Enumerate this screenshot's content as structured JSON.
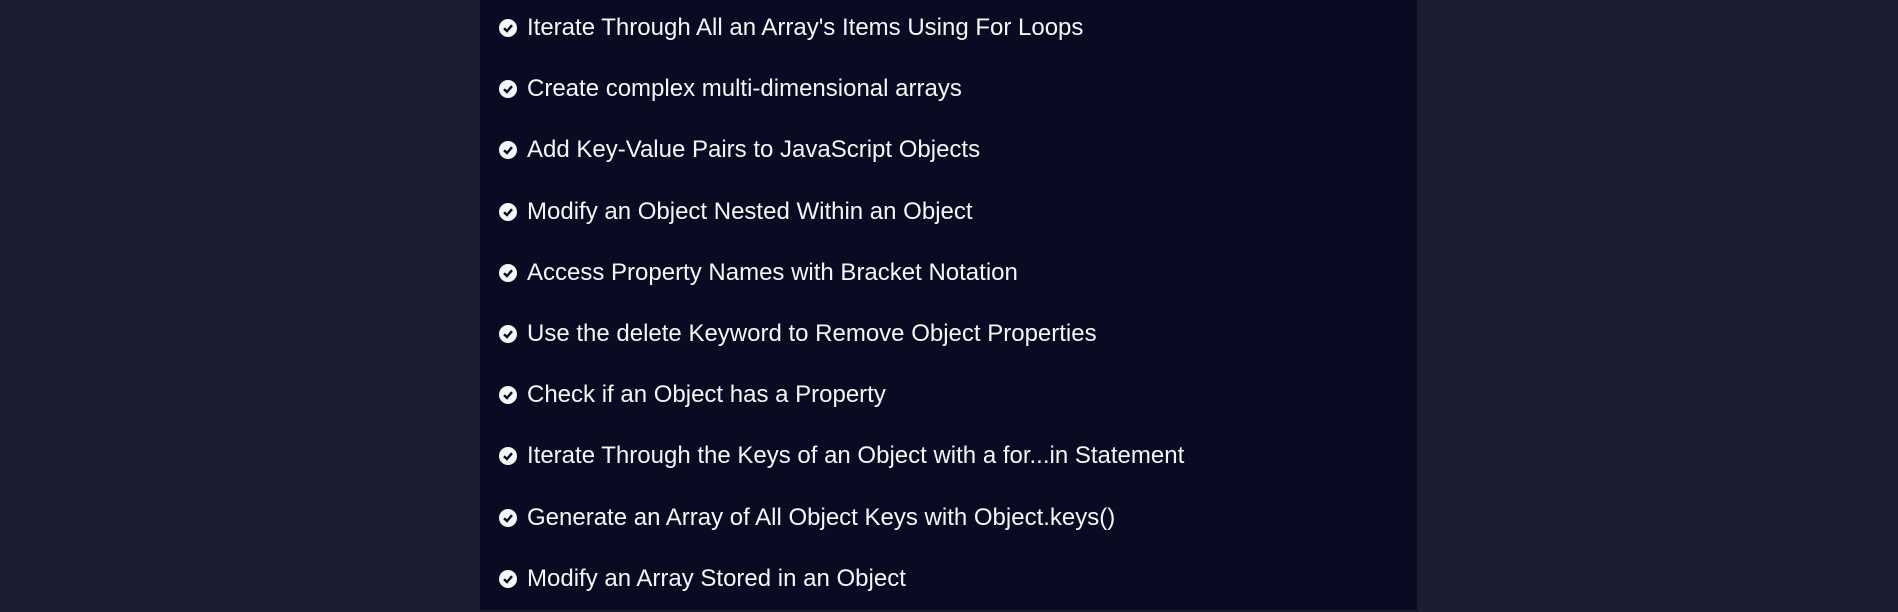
{
  "colors": {
    "background": "#1b1b32",
    "panel": "#0a0a23",
    "text": "#f5f6f7"
  },
  "items": [
    {
      "label": "Iterate Through All an Array's Items Using For Loops",
      "icon": "check-circle-icon"
    },
    {
      "label": "Create complex multi-dimensional arrays",
      "icon": "check-circle-icon"
    },
    {
      "label": "Add Key-Value Pairs to JavaScript Objects",
      "icon": "check-circle-icon"
    },
    {
      "label": "Modify an Object Nested Within an Object",
      "icon": "check-circle-icon"
    },
    {
      "label": "Access Property Names with Bracket Notation",
      "icon": "check-circle-icon"
    },
    {
      "label": "Use the delete Keyword to Remove Object Properties",
      "icon": "check-circle-icon"
    },
    {
      "label": "Check if an Object has a Property",
      "icon": "check-circle-icon"
    },
    {
      "label": "Iterate Through the Keys of an Object with a for...in Statement",
      "icon": "check-circle-icon"
    },
    {
      "label": "Generate an Array of All Object Keys with Object.keys()",
      "icon": "check-circle-icon"
    },
    {
      "label": "Modify an Array Stored in an Object",
      "icon": "check-circle-icon"
    }
  ]
}
